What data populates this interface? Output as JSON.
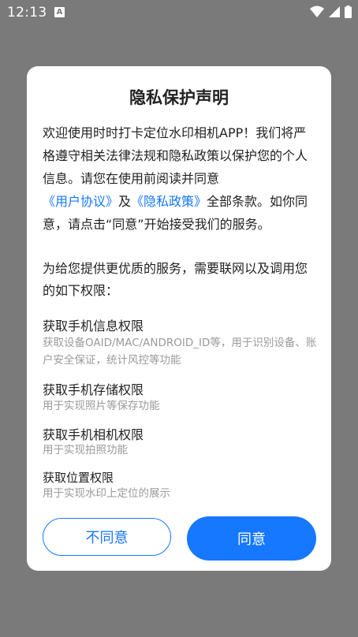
{
  "status": {
    "time": "12:13",
    "notification_icon_letter": "A"
  },
  "dialog": {
    "title": "隐私保护声明",
    "intro": {
      "part1": "欢迎使用时时打卡定位水印相机APP！我们将严格遵守相关法律法规和隐私政策以保护您的个人信息。请您在使用前阅读并同意",
      "link_user_agreement": "《用户协议》",
      "and": "及",
      "link_privacy_policy": "《隐私政策》",
      "part2": "全部条款。如你同意，请点击“同意”开始接受我们的服务。"
    },
    "perm_intro": "为给您提供更优质的服务，需要联网以及调用您的如下权限：",
    "permissions": [
      {
        "title": "获取手机信息权限",
        "desc": "获取设备OAID/MAC/ANDROID_ID等，用于识别设备、账户安全保证，统计风控等功能"
      },
      {
        "title": "获取手机存储权限",
        "desc": "用于实现照片等保存功能"
      },
      {
        "title": "获取手机相机权限",
        "desc": "用于实现拍照功能"
      },
      {
        "title": "获取位置权限",
        "desc": "用于实现水印上定位的展示"
      }
    ],
    "buttons": {
      "decline": "不同意",
      "agree": "同意"
    }
  }
}
